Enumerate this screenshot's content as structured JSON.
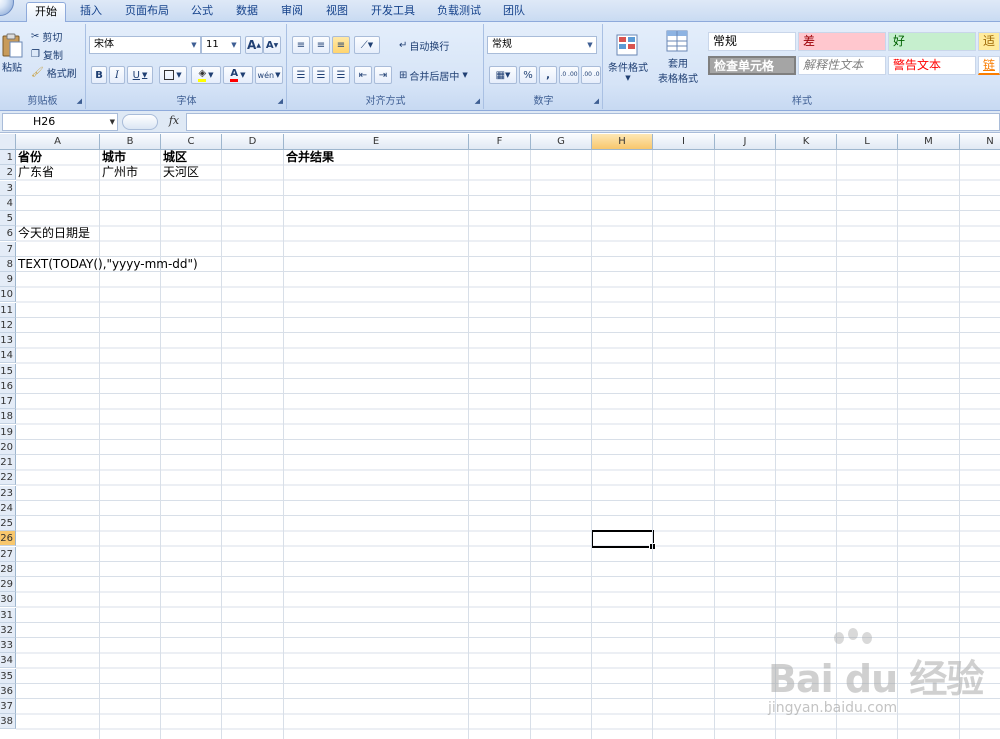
{
  "tabs": [
    {
      "label": "开始",
      "active": true
    },
    {
      "label": "插入"
    },
    {
      "label": "页面布局"
    },
    {
      "label": "公式"
    },
    {
      "label": "数据"
    },
    {
      "label": "审阅"
    },
    {
      "label": "视图"
    },
    {
      "label": "开发工具"
    },
    {
      "label": "负载测试"
    },
    {
      "label": "团队"
    }
  ],
  "clipboard": {
    "paste": "粘贴",
    "cut": "剪切",
    "copy": "复制",
    "format_painter": "格式刷",
    "title": "剪贴板"
  },
  "font": {
    "name": "宋体",
    "size": "11",
    "grow": "A",
    "shrink": "A",
    "bold": "B",
    "italic": "I",
    "underline": "U",
    "font_color_glyph": "A",
    "phonetic": "wén",
    "title": "字体"
  },
  "alignment": {
    "wrap_text": "自动换行",
    "merge_center": "合并后居中",
    "title": "对齐方式"
  },
  "number": {
    "format": "常规",
    "percent": "%",
    "comma": ",",
    "inc_decimal": ".0 .00",
    "dec_decimal": ".00 .0",
    "title": "数字"
  },
  "styles": {
    "conditional_format": "条件格式",
    "table_format_1": "套用",
    "table_format_2": "表格格式",
    "cells": [
      {
        "label": "常规",
        "bg": "#ffffff",
        "color": "#000000"
      },
      {
        "label": "差",
        "bg": "#ffc7ce",
        "color": "#9c0006"
      },
      {
        "label": "好",
        "bg": "#c6efce",
        "color": "#006100"
      },
      {
        "label": "适中",
        "bg": "#ffeb9c",
        "color": "#9c6500"
      },
      {
        "label": "检查单元格",
        "bg": "#a5a5a5",
        "color": "#ffffff"
      },
      {
        "label": "解释性文本",
        "bg": "#ffffff",
        "color": "#7f7f7f"
      },
      {
        "label": "警告文本",
        "bg": "#ffffff",
        "color": "#ff0000"
      },
      {
        "label": "链接单元格",
        "bg": "#ffffff",
        "color": "#fa7d00"
      }
    ],
    "title": "样式"
  },
  "formula_bar": {
    "name_box": "H26",
    "fx": "fx",
    "content": ""
  },
  "columns": [
    "A",
    "B",
    "C",
    "D",
    "E",
    "F",
    "G",
    "H",
    "I",
    "J",
    "K",
    "L",
    "M",
    "N"
  ],
  "selected_column": "H",
  "rows": [
    "1",
    "2",
    "3",
    "4",
    "5",
    "6",
    "7",
    "8",
    "9",
    "10",
    "11",
    "12",
    "13",
    "14",
    "15",
    "16",
    "17",
    "18",
    "19",
    "20",
    "21",
    "22",
    "23",
    "24",
    "25",
    "26",
    "27",
    "28",
    "29",
    "30",
    "31",
    "32",
    "33",
    "34",
    "35",
    "36",
    "37",
    "38"
  ],
  "selected_row": "26",
  "cell_values": {
    "A1": "省份",
    "B1": "城市",
    "C1": "城区",
    "E1": "合并结果",
    "A2": "广东省",
    "B2": "广州市",
    "C2": "天河区",
    "A6": "今天的日期是",
    "A8": "TEXT(TODAY(),\"yyyy-mm-dd\")"
  },
  "watermark": {
    "brand": "Bai du 经验",
    "url": "jingyan.baidu.com"
  }
}
